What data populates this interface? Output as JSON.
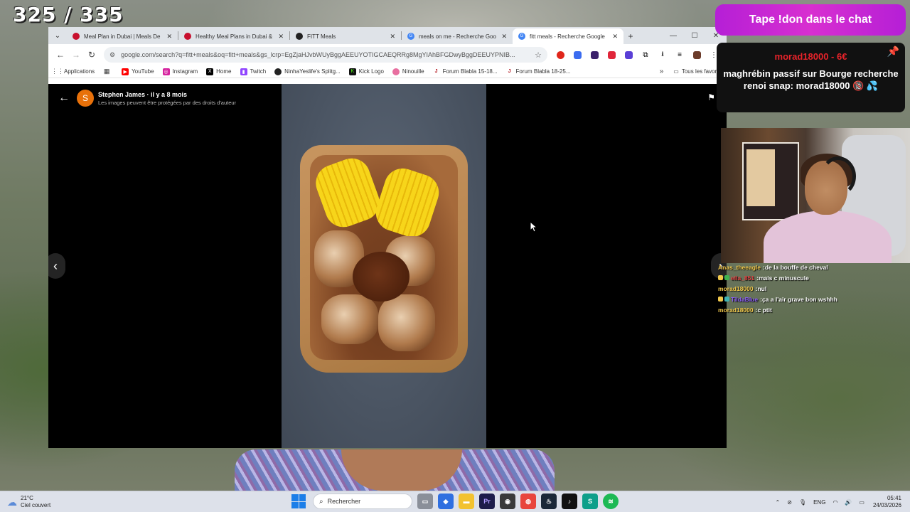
{
  "stream": {
    "counter": "325 / 335",
    "don_banner": "Tape !don dans le chat",
    "donation": {
      "user_amount": "morad18000 - 6€",
      "message": "maghrébin passif sur Bourge recherche renoi snap: morad18000 🔞 💦"
    },
    "chat": [
      {
        "user": "Anas_theeagle",
        "text": "de la bouffe de cheval",
        "user_color": "#f2c94c"
      },
      {
        "user": "ella_851",
        "text": "mais c minuscule",
        "user_color": "#e64545"
      },
      {
        "user": "morad18000",
        "text": "nul",
        "user_color": "#f2c94c"
      },
      {
        "user": "TildaBlue",
        "text": "ça a l'air grave bon wshhh",
        "user_color": "#8a5cf6"
      },
      {
        "user": "morad18000",
        "text": "c ptit",
        "user_color": "#f2c94c"
      }
    ]
  },
  "browser": {
    "tabs": [
      {
        "title": "Meal Plan in Dubai | Meals De",
        "icon_color": "#c8102e",
        "active": false
      },
      {
        "title": "Healthy Meal Plans in Dubai &",
        "icon_color": "#c8102e",
        "active": false
      },
      {
        "title": "FITT Meals",
        "icon_color": "#222222",
        "active": false
      },
      {
        "title": "meals on me - Recherche Goo",
        "icon_color": "#4285f4",
        "active": false
      },
      {
        "title": "fitt meals - Recherche Google",
        "icon_color": "#4285f4",
        "active": true
      }
    ],
    "url": "google.com/search?q=fitt+meals&oq=fitt+meals&gs_lcrp=EgZjaHJvbWUyBggAEEUYOTIGCAEQRRg8MgYIAhBFGDwyBggDEEUYPNIB...",
    "bookmarks": [
      {
        "label": "Applications",
        "icon": "apps-icon",
        "color": "#666666"
      },
      {
        "label": "",
        "icon": "grid-icon",
        "color": "#333333"
      },
      {
        "label": "YouTube",
        "icon": "youtube-icon",
        "color": "#ff0000"
      },
      {
        "label": "Instagram",
        "icon": "instagram-icon",
        "color": "#d6249f"
      },
      {
        "label": "Home",
        "icon": "x-icon",
        "color": "#000000"
      },
      {
        "label": "Twitch",
        "icon": "twitch-icon",
        "color": "#9146ff"
      },
      {
        "label": "NinhaYeslife's Splitg...",
        "icon": "circle-icon",
        "color": "#222222"
      },
      {
        "label": "Kick Logo",
        "icon": "kick-icon",
        "color": "#53fc18"
      },
      {
        "label": "Ninouille",
        "icon": "circle-icon",
        "color": "#e86fa0"
      },
      {
        "label": "Forum Blabla 15-18...",
        "icon": "jv-icon",
        "color": "#b3161e"
      },
      {
        "label": "Forum Blabla 18-25...",
        "icon": "jv-icon",
        "color": "#b3161e"
      }
    ],
    "bookmarks_more": "»",
    "bookmarks_folder": "Tous les favoris"
  },
  "viewer": {
    "author_initial": "S",
    "author": "Stephen James",
    "time": "il y a 8 mois",
    "notice": "Les images peuvent être protégées par des droits d'auteur"
  },
  "taskbar": {
    "temp": "21°C",
    "weather": "Ciel couvert",
    "search": "Rechercher",
    "lang": "ENG",
    "time": "05:41",
    "date": "24/03/2026"
  }
}
